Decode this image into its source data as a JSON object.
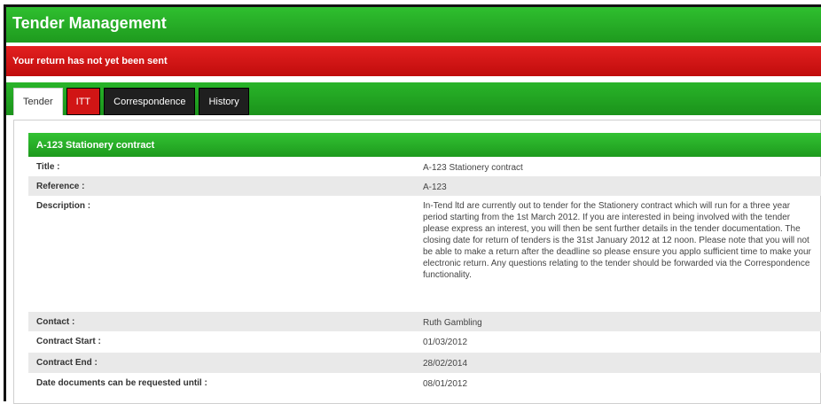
{
  "header": {
    "title": "Tender Management"
  },
  "alert": {
    "text": "Your return has not yet been sent"
  },
  "tabs": [
    {
      "label": "Tender",
      "state": "active"
    },
    {
      "label": "ITT",
      "state": "alert"
    },
    {
      "label": "Correspondence",
      "state": "normal"
    },
    {
      "label": "History",
      "state": "normal"
    }
  ],
  "panel": {
    "heading": "A-123 Stationery contract",
    "rows": [
      {
        "label": "Title :",
        "value": "A-123 Stationery contract"
      },
      {
        "label": "Reference :",
        "value": "A-123"
      },
      {
        "label": "Description :",
        "value": "In-Tend ltd are currently out to tender for the Stationery contract which will run for a three year period starting from the 1st March 2012. If you are interested in being involved with the tender please express an interest, you will then be sent further details in the tender documentation. The closing date for return of tenders is the 31st January 2012 at 12 noon. Please note that you will not be able to make a return after the deadline so please ensure you applo sufficient time to make your electronic return. Any questions relating to the tender should be forwarded via the Correspondence functionality."
      },
      {
        "label": "Contact :",
        "value": "Ruth Gambling"
      },
      {
        "label": "Contract Start :",
        "value": "01/03/2012"
      },
      {
        "label": "Contract End :",
        "value": "28/02/2014"
      },
      {
        "label": "Date documents can be requested until :",
        "value": "08/01/2012"
      }
    ]
  },
  "colors": {
    "green": "#22a822",
    "red": "#c81010",
    "tab_dark": "#1f1f1f"
  }
}
